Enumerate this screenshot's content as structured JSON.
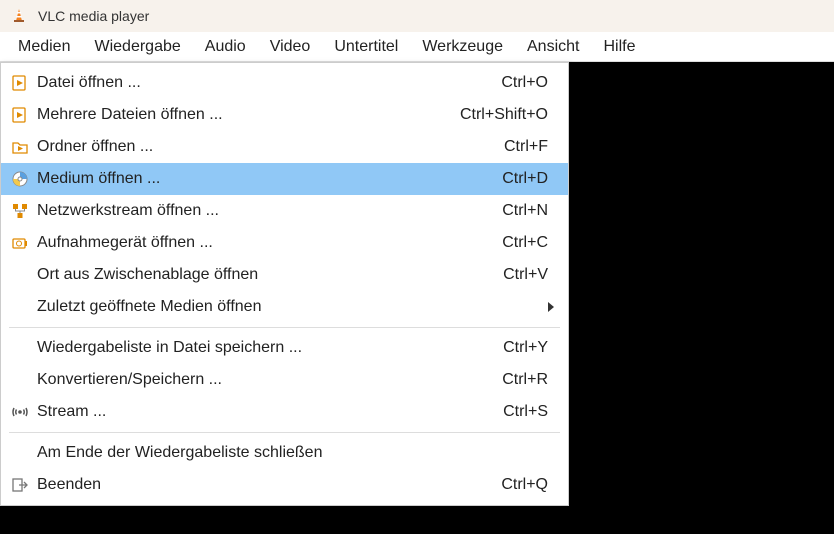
{
  "title": "VLC media player",
  "menubar": [
    {
      "label": "Medien"
    },
    {
      "label": "Wiedergabe"
    },
    {
      "label": "Audio"
    },
    {
      "label": "Video"
    },
    {
      "label": "Untertitel"
    },
    {
      "label": "Werkzeuge"
    },
    {
      "label": "Ansicht"
    },
    {
      "label": "Hilfe"
    }
  ],
  "menubar_active": 0,
  "menu": {
    "items": [
      {
        "icon": "file-play",
        "label": "Datei öffnen ...",
        "shortcut": "Ctrl+O"
      },
      {
        "icon": "file-play",
        "label": "Mehrere Dateien öffnen ...",
        "shortcut": "Ctrl+Shift+O"
      },
      {
        "icon": "folder-play",
        "label": "Ordner öffnen ...",
        "shortcut": "Ctrl+F"
      },
      {
        "icon": "disc",
        "label": "Medium öffnen ...",
        "shortcut": "Ctrl+D",
        "highlight": true
      },
      {
        "icon": "network",
        "label": "Netzwerkstream öffnen ...",
        "shortcut": "Ctrl+N"
      },
      {
        "icon": "capture",
        "label": "Aufnahmegerät öffnen ...",
        "shortcut": "Ctrl+C"
      },
      {
        "icon": "",
        "label": "Ort aus Zwischenablage öffnen",
        "shortcut": "Ctrl+V"
      },
      {
        "icon": "",
        "label": "Zuletzt geöffnete Medien öffnen",
        "shortcut": "",
        "submenu": true
      },
      {
        "separator": true
      },
      {
        "icon": "",
        "label": "Wiedergabeliste in Datei speichern ...",
        "shortcut": "Ctrl+Y"
      },
      {
        "icon": "",
        "label": "Konvertieren/Speichern ...",
        "shortcut": "Ctrl+R"
      },
      {
        "icon": "stream",
        "label": "Stream ...",
        "shortcut": "Ctrl+S"
      },
      {
        "separator": true
      },
      {
        "icon": "",
        "label": "Am Ende der Wiedergabeliste schließen",
        "shortcut": ""
      },
      {
        "icon": "exit",
        "label": "Beenden",
        "shortcut": "Ctrl+Q"
      }
    ]
  }
}
